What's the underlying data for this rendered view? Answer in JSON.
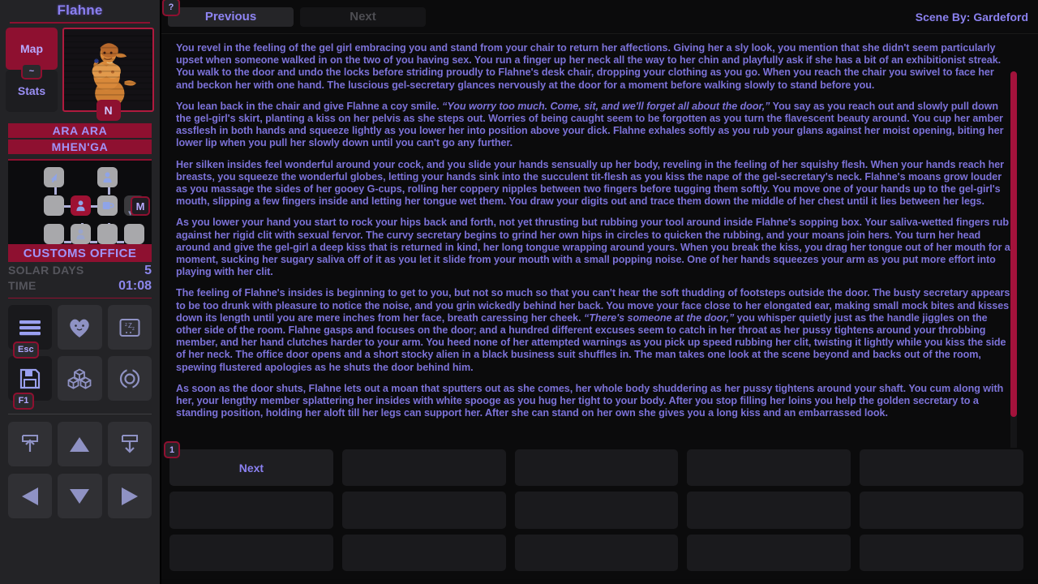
{
  "sidebar": {
    "character_name": "Flahne",
    "map_button": "Map",
    "map_hotkey": "~",
    "stats_button": "Stats",
    "portrait_badge": "N",
    "banners": [
      "ARA ARA",
      "MHEN'GA"
    ],
    "map": {
      "m_badge": "M",
      "cells": [
        {
          "id": "c-0-1",
          "icon": "cursor-icon",
          "state": "normal"
        },
        {
          "id": "c-0-3",
          "icon": "person-icon",
          "state": "normal"
        },
        {
          "id": "c-1-0",
          "icon": "none",
          "state": "normal"
        },
        {
          "id": "c-1-1",
          "icon": "person-icon",
          "state": "current"
        },
        {
          "id": "c-1-2",
          "icon": "mug-icon",
          "state": "normal"
        },
        {
          "id": "c-1-4",
          "icon": "none",
          "state": "dim"
        },
        {
          "id": "c-2-0",
          "icon": "none",
          "state": "normal"
        },
        {
          "id": "c-2-1",
          "icon": "person-faded-icon",
          "state": "normal"
        },
        {
          "id": "c-2-2",
          "icon": "none",
          "state": "normal"
        },
        {
          "id": "c-2-3",
          "icon": "none",
          "state": "normal"
        }
      ]
    },
    "location": "CUSTOMS OFFICE",
    "stats": [
      {
        "label": "SOLAR DAYS",
        "value": "5"
      },
      {
        "label": "TIME",
        "value": "01:08"
      }
    ],
    "icon_buttons": [
      {
        "name": "menu-icon",
        "hotkey": "Esc",
        "lit": true
      },
      {
        "name": "heart-icon",
        "hotkey": "",
        "lit": false
      },
      {
        "name": "sleep-icon",
        "hotkey": "",
        "lit": false
      },
      {
        "name": "save-icon",
        "hotkey": "F1",
        "lit": true
      },
      {
        "name": "inventory-icon",
        "hotkey": "",
        "lit": false
      },
      {
        "name": "reload-icon",
        "hotkey": "",
        "lit": false
      }
    ],
    "nav_buttons_upper": [
      {
        "name": "upload-icon"
      },
      {
        "name": "arrow-up-icon"
      },
      {
        "name": "download-icon"
      }
    ],
    "nav_buttons_lower": [
      {
        "name": "arrow-left-icon"
      },
      {
        "name": "arrow-down-icon"
      },
      {
        "name": "arrow-right-icon"
      }
    ]
  },
  "topbar": {
    "help_hotkey": "?",
    "previous_label": "Previous",
    "next_label": "Next",
    "scene_by": "Scene By: Gardeford"
  },
  "story": {
    "paragraphs": [
      {
        "id": "p1",
        "runs": [
          {
            "text": "You revel in the feeling of the gel girl embracing you and stand from your chair to return her affections. Giving her a sly look, you mention that she didn't seem particularly upset when someone walked in on the two of you having sex. You run a finger up her neck all the way to her chin and playfully ask if she has a bit of an exhibitionist streak. You walk to the door and undo the locks before striding proudly to Flahne's desk chair, dropping your clothing as you go. When you reach the chair you swivel to face her and beckon her with one hand. The luscious gel-secretary glances nervously at the door for a moment before walking slowly to stand before you.",
            "italic": false
          }
        ]
      },
      {
        "id": "p2",
        "runs": [
          {
            "text": "You lean back in the chair and give Flahne a coy smile. ",
            "italic": false
          },
          {
            "text": "“You worry too much. Come, sit, and we'll forget all about the door,”",
            "italic": true
          },
          {
            "text": " You say as you reach out and slowly pull down the gel-girl's skirt, planting a kiss on her pelvis as she steps out. Worries of being caught seem to be forgotten as you turn the flavescent beauty around. You cup her amber assflesh in both hands and squeeze lightly as you lower her into position above your dick. Flahne exhales softly as you rub your glans against her moist opening, biting her lower lip when you pull her slowly down until you can't go any further.",
            "italic": false
          }
        ]
      },
      {
        "id": "p3",
        "runs": [
          {
            "text": "Her silken insides feel wonderful around your cock, and you slide your hands sensually up her body, reveling in the feeling of her squishy flesh. When your hands reach her breasts, you squeeze the wonderful globes, letting your hands sink into the succulent tit-flesh as you kiss the nape of the gel-secretary's neck. Flahne's moans grow louder as you massage the sides of her gooey G-cups, rolling her coppery nipples between two fingers before tugging them softly. You move one of your hands up to the gel-girl's mouth, slipping a few fingers inside and letting her tongue wet them. You draw your digits out and trace them down the middle of her chest until it lies between her legs.",
            "italic": false
          }
        ]
      },
      {
        "id": "p4",
        "runs": [
          {
            "text": "As you lower your hand you start to rock your hips back and forth, not yet thrusting but rubbing your tool around inside Flahne's sopping box. Your saliva-wetted fingers rub against her rigid clit with sexual fervor. The curvy secretary begins to grind her own hips in circles to quicken the rubbing, and your moans join hers. You turn her head around and give the gel-girl a deep kiss that is returned in kind, her long tongue wrapping around yours. When you break the kiss, you drag her tongue out of her mouth for a moment, sucking her sugary saliva off of it as you let it slide from your mouth with a small popping noise. One of her hands squeezes your arm as you put more effort into playing with her clit.",
            "italic": false
          }
        ]
      },
      {
        "id": "p5",
        "runs": [
          {
            "text": "The feeling of Flahne's insides is beginning to get to you, but not so much so that you can't hear the soft thudding of footsteps outside the door. The busty secretary appears to be too drunk with pleasure to notice the noise, and you grin wickedly behind her back. You move your face close to her elongated ear, making small mock bites and kisses down its length until you are mere inches from her face, breath caressing her cheek. ",
            "italic": false
          },
          {
            "text": "“There's someone at the door,”",
            "italic": true
          },
          {
            "text": " you whisper quietly just as the handle jiggles on the other side of the room. Flahne gasps and focuses on the door; and a hundred different excuses seem to catch in her throat as her pussy tightens around your throbbing member, and her hand clutches harder to your arm. You heed none of her attempted warnings as you pick up speed rubbing her clit, twisting it lightly while you kiss the side of her neck. The office door opens and a short stocky alien in a black business suit shuffles in. The man takes one look at the scene beyond and backs out of the room, spewing flustered apologies as he shuts the door behind him.",
            "italic": false
          }
        ]
      },
      {
        "id": "p6",
        "runs": [
          {
            "text": "As soon as the door shuts, Flahne lets out a moan that sputters out as she comes, her whole body shuddering as her pussy tightens around your shaft. You cum along with her, your lengthy member splattering her insides with white spooge as you hug her tight to your body. After you stop filling her loins you help the golden secretary to a standing position, holding her aloft till her legs can support her. After she can stand on her own she gives you a long kiss and an embarrassed look.",
            "italic": false
          }
        ]
      }
    ]
  },
  "choices": [
    {
      "label": "Next",
      "hotkey": "1",
      "empty": false
    },
    {
      "label": "",
      "hotkey": "",
      "empty": true
    },
    {
      "label": "",
      "hotkey": "",
      "empty": true
    },
    {
      "label": "",
      "hotkey": "",
      "empty": true
    },
    {
      "label": "",
      "hotkey": "",
      "empty": true
    },
    {
      "label": "",
      "hotkey": "",
      "empty": true
    },
    {
      "label": "",
      "hotkey": "",
      "empty": true
    },
    {
      "label": "",
      "hotkey": "",
      "empty": true
    },
    {
      "label": "",
      "hotkey": "",
      "empty": true
    },
    {
      "label": "",
      "hotkey": "",
      "empty": true
    },
    {
      "label": "",
      "hotkey": "",
      "empty": true
    },
    {
      "label": "",
      "hotkey": "",
      "empty": true
    },
    {
      "label": "",
      "hotkey": "",
      "empty": true
    },
    {
      "label": "",
      "hotkey": "",
      "empty": true
    },
    {
      "label": "",
      "hotkey": "",
      "empty": true
    }
  ],
  "colors": {
    "accent_crimson": "#8e1030",
    "text_purple": "#7c72d8",
    "bg_dark": "#0b0b0c",
    "sidebar_bg": "#232326"
  }
}
